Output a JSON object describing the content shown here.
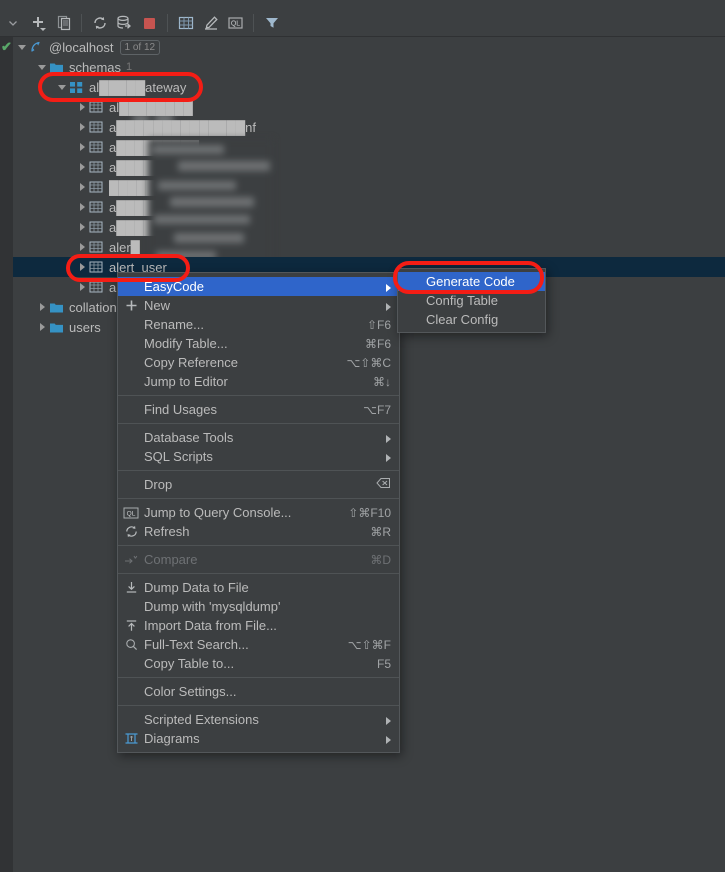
{
  "app": {
    "theme_bg": "#3c3f41",
    "accent_selection": "#2f65ca",
    "tree_selection": "#0d293e",
    "annotation_color": "#f41d15"
  },
  "toolbar": {
    "collapse_label": "chevron-down",
    "buttons": [
      {
        "name": "add-icon",
        "label": "Add"
      },
      {
        "name": "copy-icon",
        "label": "Duplicate"
      },
      {
        "name": "refresh-icon",
        "label": "Refresh"
      },
      {
        "name": "sync-db-icon",
        "label": "Synchronize"
      },
      {
        "name": "stop-icon",
        "label": "Stop"
      },
      {
        "name": "table-icon",
        "label": "Table Editor"
      },
      {
        "name": "edit-icon",
        "label": "Modify"
      },
      {
        "name": "query-console-icon",
        "label": "Query Console"
      },
      {
        "name": "filter-icon",
        "label": "Filter"
      }
    ]
  },
  "tree": {
    "root": {
      "label": "@localhost",
      "badge": "1 of 12",
      "icon": "database-icon",
      "status": "✔"
    },
    "schemas": {
      "label": "schemas",
      "count": "1",
      "icon": "folder-icon"
    },
    "schema": {
      "label": "al█████ateway",
      "icon": "schema-icon"
    },
    "tables": [
      {
        "label": "al████████",
        "icon": "table-icon",
        "redacted": true
      },
      {
        "label": "a██████████████nf",
        "icon": "table-icon",
        "redacted": true
      },
      {
        "label": "a█████████",
        "icon": "table-icon",
        "redacted": true
      },
      {
        "label": "a████████████er",
        "icon": "table-icon",
        "redacted": true
      },
      {
        "label": "█████████io█",
        "icon": "table-icon",
        "redacted": true
      },
      {
        "label": "a█████████████",
        "icon": "table-icon",
        "redacted": true
      },
      {
        "label": "a██████ce",
        "icon": "table-icon",
        "redacted": true
      },
      {
        "label": "aler█",
        "icon": "table-icon",
        "redacted": true
      }
    ],
    "selected_table": {
      "label": "alert_user",
      "icon": "table-icon"
    },
    "hidden_table": {
      "label": "a",
      "icon": "table-icon"
    },
    "folders": [
      {
        "label": "collations",
        "count": "",
        "icon": "folder-icon"
      },
      {
        "label": "users",
        "count": "",
        "icon": "folder-icon"
      }
    ]
  },
  "context_menu": {
    "groups": [
      {
        "items": [
          {
            "label": "EasyCode",
            "shortcut": "",
            "icon": "",
            "submenu": true,
            "highlighted": true,
            "disabled": false
          },
          {
            "label": "New",
            "shortcut": "",
            "icon": "plus-icon",
            "submenu": true,
            "highlighted": false,
            "disabled": false
          },
          {
            "label": "Rename...",
            "shortcut": "⇧F6",
            "icon": "",
            "submenu": false,
            "highlighted": false,
            "disabled": false
          },
          {
            "label": "Modify Table...",
            "shortcut": "⌘F6",
            "icon": "",
            "submenu": false,
            "highlighted": false,
            "disabled": false
          },
          {
            "label": "Copy Reference",
            "shortcut": "⌥⇧⌘C",
            "icon": "",
            "submenu": false,
            "highlighted": false,
            "disabled": false
          },
          {
            "label": "Jump to Editor",
            "shortcut": "⌘↓",
            "icon": "",
            "submenu": false,
            "highlighted": false,
            "disabled": false
          }
        ]
      },
      {
        "items": [
          {
            "label": "Find Usages",
            "shortcut": "⌥F7",
            "icon": "",
            "submenu": false,
            "highlighted": false,
            "disabled": false
          }
        ]
      },
      {
        "items": [
          {
            "label": "Database Tools",
            "shortcut": "",
            "icon": "",
            "submenu": true,
            "highlighted": false,
            "disabled": false
          },
          {
            "label": "SQL Scripts",
            "shortcut": "",
            "icon": "",
            "submenu": true,
            "highlighted": false,
            "disabled": false
          }
        ]
      },
      {
        "items": [
          {
            "label": "Drop",
            "shortcut": "",
            "icon": "drop-icon",
            "submenu": false,
            "highlighted": false,
            "disabled": false,
            "trailing_icon": "delete-tag-icon"
          }
        ]
      },
      {
        "items": [
          {
            "label": "Jump to Query Console...",
            "shortcut": "⇧⌘F10",
            "icon": "query-console-icon",
            "submenu": false,
            "highlighted": false,
            "disabled": false
          },
          {
            "label": "Refresh",
            "shortcut": "⌘R",
            "icon": "refresh-icon",
            "submenu": false,
            "highlighted": false,
            "disabled": false
          }
        ]
      },
      {
        "items": [
          {
            "label": "Compare",
            "shortcut": "⌘D",
            "icon": "compare-icon",
            "submenu": false,
            "highlighted": false,
            "disabled": true
          }
        ]
      },
      {
        "items": [
          {
            "label": "Dump Data to File",
            "shortcut": "",
            "icon": "download-icon",
            "submenu": false,
            "highlighted": false,
            "disabled": false
          },
          {
            "label": "Dump with 'mysqldump'",
            "shortcut": "",
            "icon": "",
            "submenu": false,
            "highlighted": false,
            "disabled": false
          },
          {
            "label": "Import Data from File...",
            "shortcut": "",
            "icon": "upload-icon",
            "submenu": false,
            "highlighted": false,
            "disabled": false
          },
          {
            "label": "Full-Text Search...",
            "shortcut": "⌥⇧⌘F",
            "icon": "search-icon",
            "submenu": false,
            "highlighted": false,
            "disabled": false
          },
          {
            "label": "Copy Table to...",
            "shortcut": "F5",
            "icon": "",
            "submenu": false,
            "highlighted": false,
            "disabled": false
          }
        ]
      },
      {
        "items": [
          {
            "label": "Color Settings...",
            "shortcut": "",
            "icon": "",
            "submenu": false,
            "highlighted": false,
            "disabled": false
          }
        ]
      },
      {
        "items": [
          {
            "label": "Scripted Extensions",
            "shortcut": "",
            "icon": "",
            "submenu": true,
            "highlighted": false,
            "disabled": false
          },
          {
            "label": "Diagrams",
            "shortcut": "",
            "icon": "diagram-icon",
            "submenu": true,
            "highlighted": false,
            "disabled": false
          }
        ]
      }
    ]
  },
  "submenu": {
    "items": [
      {
        "label": "Generate Code",
        "highlighted": true
      },
      {
        "label": "Config Table",
        "highlighted": false
      },
      {
        "label": "Clear Config",
        "highlighted": false
      }
    ]
  }
}
